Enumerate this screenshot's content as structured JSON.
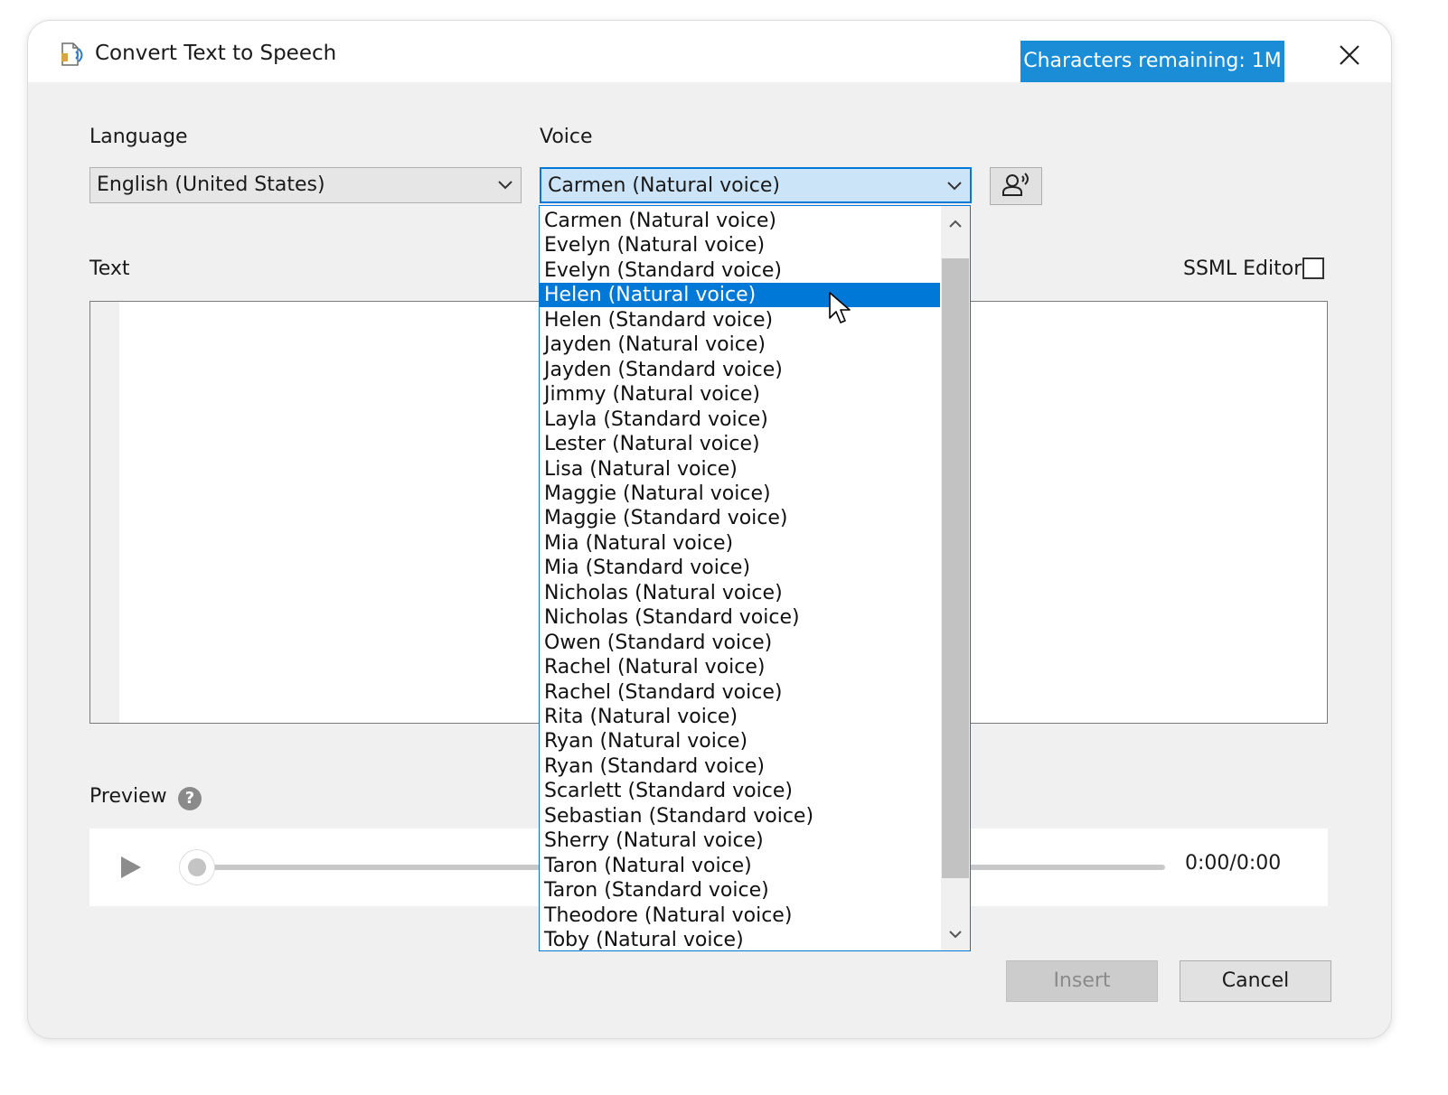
{
  "window": {
    "title": "Convert Text to Speech",
    "characters_badge": "Characters remaining: 1M",
    "icons": {
      "app": "speech-document-icon",
      "close": "close-icon"
    }
  },
  "language": {
    "label": "Language",
    "selected": "English (United States)"
  },
  "voice": {
    "label": "Voice",
    "selected": "Carmen (Natural voice)",
    "settings_icon": "voice-person-icon",
    "options": [
      "Carmen (Natural voice)",
      "Evelyn (Natural voice)",
      "Evelyn (Standard voice)",
      "Helen (Natural voice)",
      "Helen (Standard voice)",
      "Jayden (Natural voice)",
      "Jayden (Standard voice)",
      "Jimmy (Natural voice)",
      "Layla (Standard voice)",
      "Lester (Natural voice)",
      "Lisa (Natural voice)",
      "Maggie (Natural voice)",
      "Maggie (Standard voice)",
      "Mia (Natural voice)",
      "Mia (Standard voice)",
      "Nicholas (Natural voice)",
      "Nicholas (Standard voice)",
      "Owen (Standard voice)",
      "Rachel (Natural voice)",
      "Rachel (Standard voice)",
      "Rita (Natural voice)",
      "Ryan (Natural voice)",
      "Ryan (Standard voice)",
      "Scarlett (Standard voice)",
      "Sebastian (Standard voice)",
      "Sherry (Natural voice)",
      "Taron (Natural voice)",
      "Taron (Standard voice)",
      "Theodore (Natural voice)",
      "Toby (Natural voice)"
    ],
    "highlighted_index": 3
  },
  "text": {
    "label": "Text",
    "ssml_editor_label": "SSML Editor",
    "ssml_editor_checked": false,
    "value": ""
  },
  "preview": {
    "label": "Preview",
    "help_icon": "?",
    "time": "0:00/0:00",
    "progress": 0
  },
  "buttons": {
    "insert": "Insert",
    "insert_enabled": false,
    "cancel": "Cancel"
  },
  "colors": {
    "accent": "#0078d7",
    "badge": "#1a8dd6",
    "dialog_bg": "#f0f0f0"
  }
}
